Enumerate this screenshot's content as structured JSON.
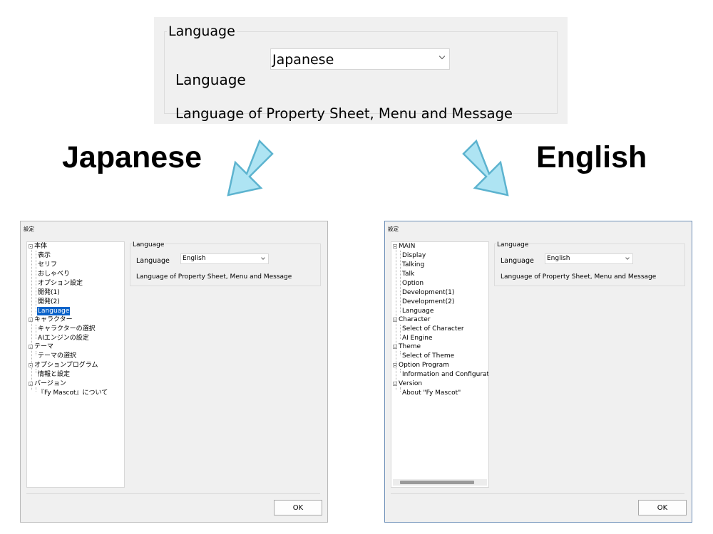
{
  "top_panel": {
    "group_title": "Language",
    "language_label": "Language",
    "language_value": "Japanese",
    "description": "Language of Property Sheet, Menu and Message"
  },
  "headings": {
    "japanese": "Japanese",
    "english": "English"
  },
  "colors": {
    "arrow_fill": "#aee4f3",
    "arrow_stroke": "#5cb3cf",
    "selection": "#0a62c9"
  },
  "dialog_ja": {
    "title": "設定",
    "tree": {
      "main": "本体",
      "display": "表示",
      "talking": "セリフ",
      "talk": "おしゃべり",
      "option": "オプション設定",
      "dev1": "開発(1)",
      "dev2": "開発(2)",
      "language": "Language",
      "character": "キャラクター",
      "select_character": "キャラクターの選択",
      "ai_engine": "AIエンジンの設定",
      "theme": "テーマ",
      "select_theme": "テーマの選択",
      "option_program": "オプションプログラム",
      "information": "情報と設定",
      "version": "バージョン",
      "about": "『Fy Mascot』について"
    },
    "page": {
      "group_title": "Language",
      "language_label": "Language",
      "language_value": "English",
      "description": "Language of Property Sheet, Menu and Message"
    },
    "ok": "OK"
  },
  "dialog_en": {
    "title": "設定",
    "tree": {
      "main": "MAIN",
      "display": "Display",
      "talking": "Talking",
      "talk": "Talk",
      "option": "Option",
      "dev1": "Development(1)",
      "dev2": "Development(2)",
      "language": "Language",
      "character": "Character",
      "select_character": "Select of Character",
      "ai_engine": "AI Engine",
      "theme": "Theme",
      "select_theme": "Select of Theme",
      "option_program": "Option Program",
      "information": "Information and Configurat",
      "version": "Version",
      "about": "About \"Fy Mascot\""
    },
    "page": {
      "group_title": "Language",
      "language_label": "Language",
      "language_value": "English",
      "description": "Language of Property Sheet, Menu and Message"
    },
    "ok": "OK"
  }
}
